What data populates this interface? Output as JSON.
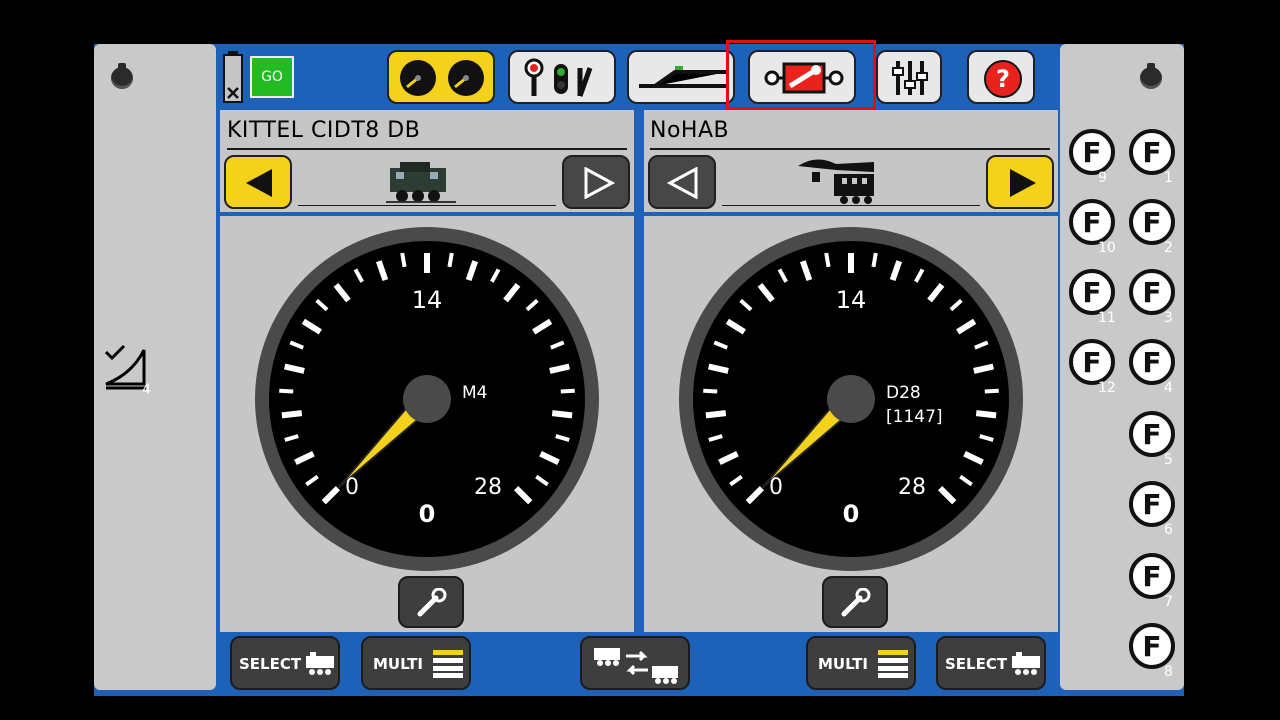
{
  "toolbar": {
    "go_label": "GO",
    "active_tab": "loco-settings"
  },
  "left_sidebar": {
    "badge_count": "4"
  },
  "cabs": [
    {
      "loco_name": "KITTEL CIDT8 DB",
      "direction": "reverse",
      "protocol_label": "M4",
      "address_label": "",
      "speed": 0,
      "speed_steps": 28,
      "scale_labels": {
        "min": "0",
        "mid": "14",
        "max": "28"
      },
      "current_speed_display": "0"
    },
    {
      "loco_name": "NoHAB",
      "direction": "forward",
      "protocol_label": "D28",
      "address_label": "[1147]",
      "speed": 0,
      "speed_steps": 28,
      "scale_labels": {
        "min": "0",
        "mid": "14",
        "max": "28"
      },
      "current_speed_display": "0"
    }
  ],
  "bottom_bar": {
    "select_label": "SELECT",
    "multi_label": "MULTI"
  },
  "function_keys": [
    {
      "label": "F",
      "number": "9"
    },
    {
      "label": "F",
      "number": "1"
    },
    {
      "label": "F",
      "number": "10"
    },
    {
      "label": "F",
      "number": "2"
    },
    {
      "label": "F",
      "number": "11"
    },
    {
      "label": "F",
      "number": "3"
    },
    {
      "label": "F",
      "number": "12"
    },
    {
      "label": "F",
      "number": "4"
    },
    {
      "label": "F",
      "number": "5"
    },
    {
      "label": "F",
      "number": "6"
    },
    {
      "label": "F",
      "number": "7"
    },
    {
      "label": "F",
      "number": "8"
    }
  ],
  "colors": {
    "background": "#000000",
    "frame_blue": "#1d62b8",
    "panel_grey": "#c6c6c6",
    "accent_yellow": "#f4d21b",
    "go_green": "#22bb22",
    "help_red": "#e8231e",
    "highlight_red": "#e01010"
  }
}
